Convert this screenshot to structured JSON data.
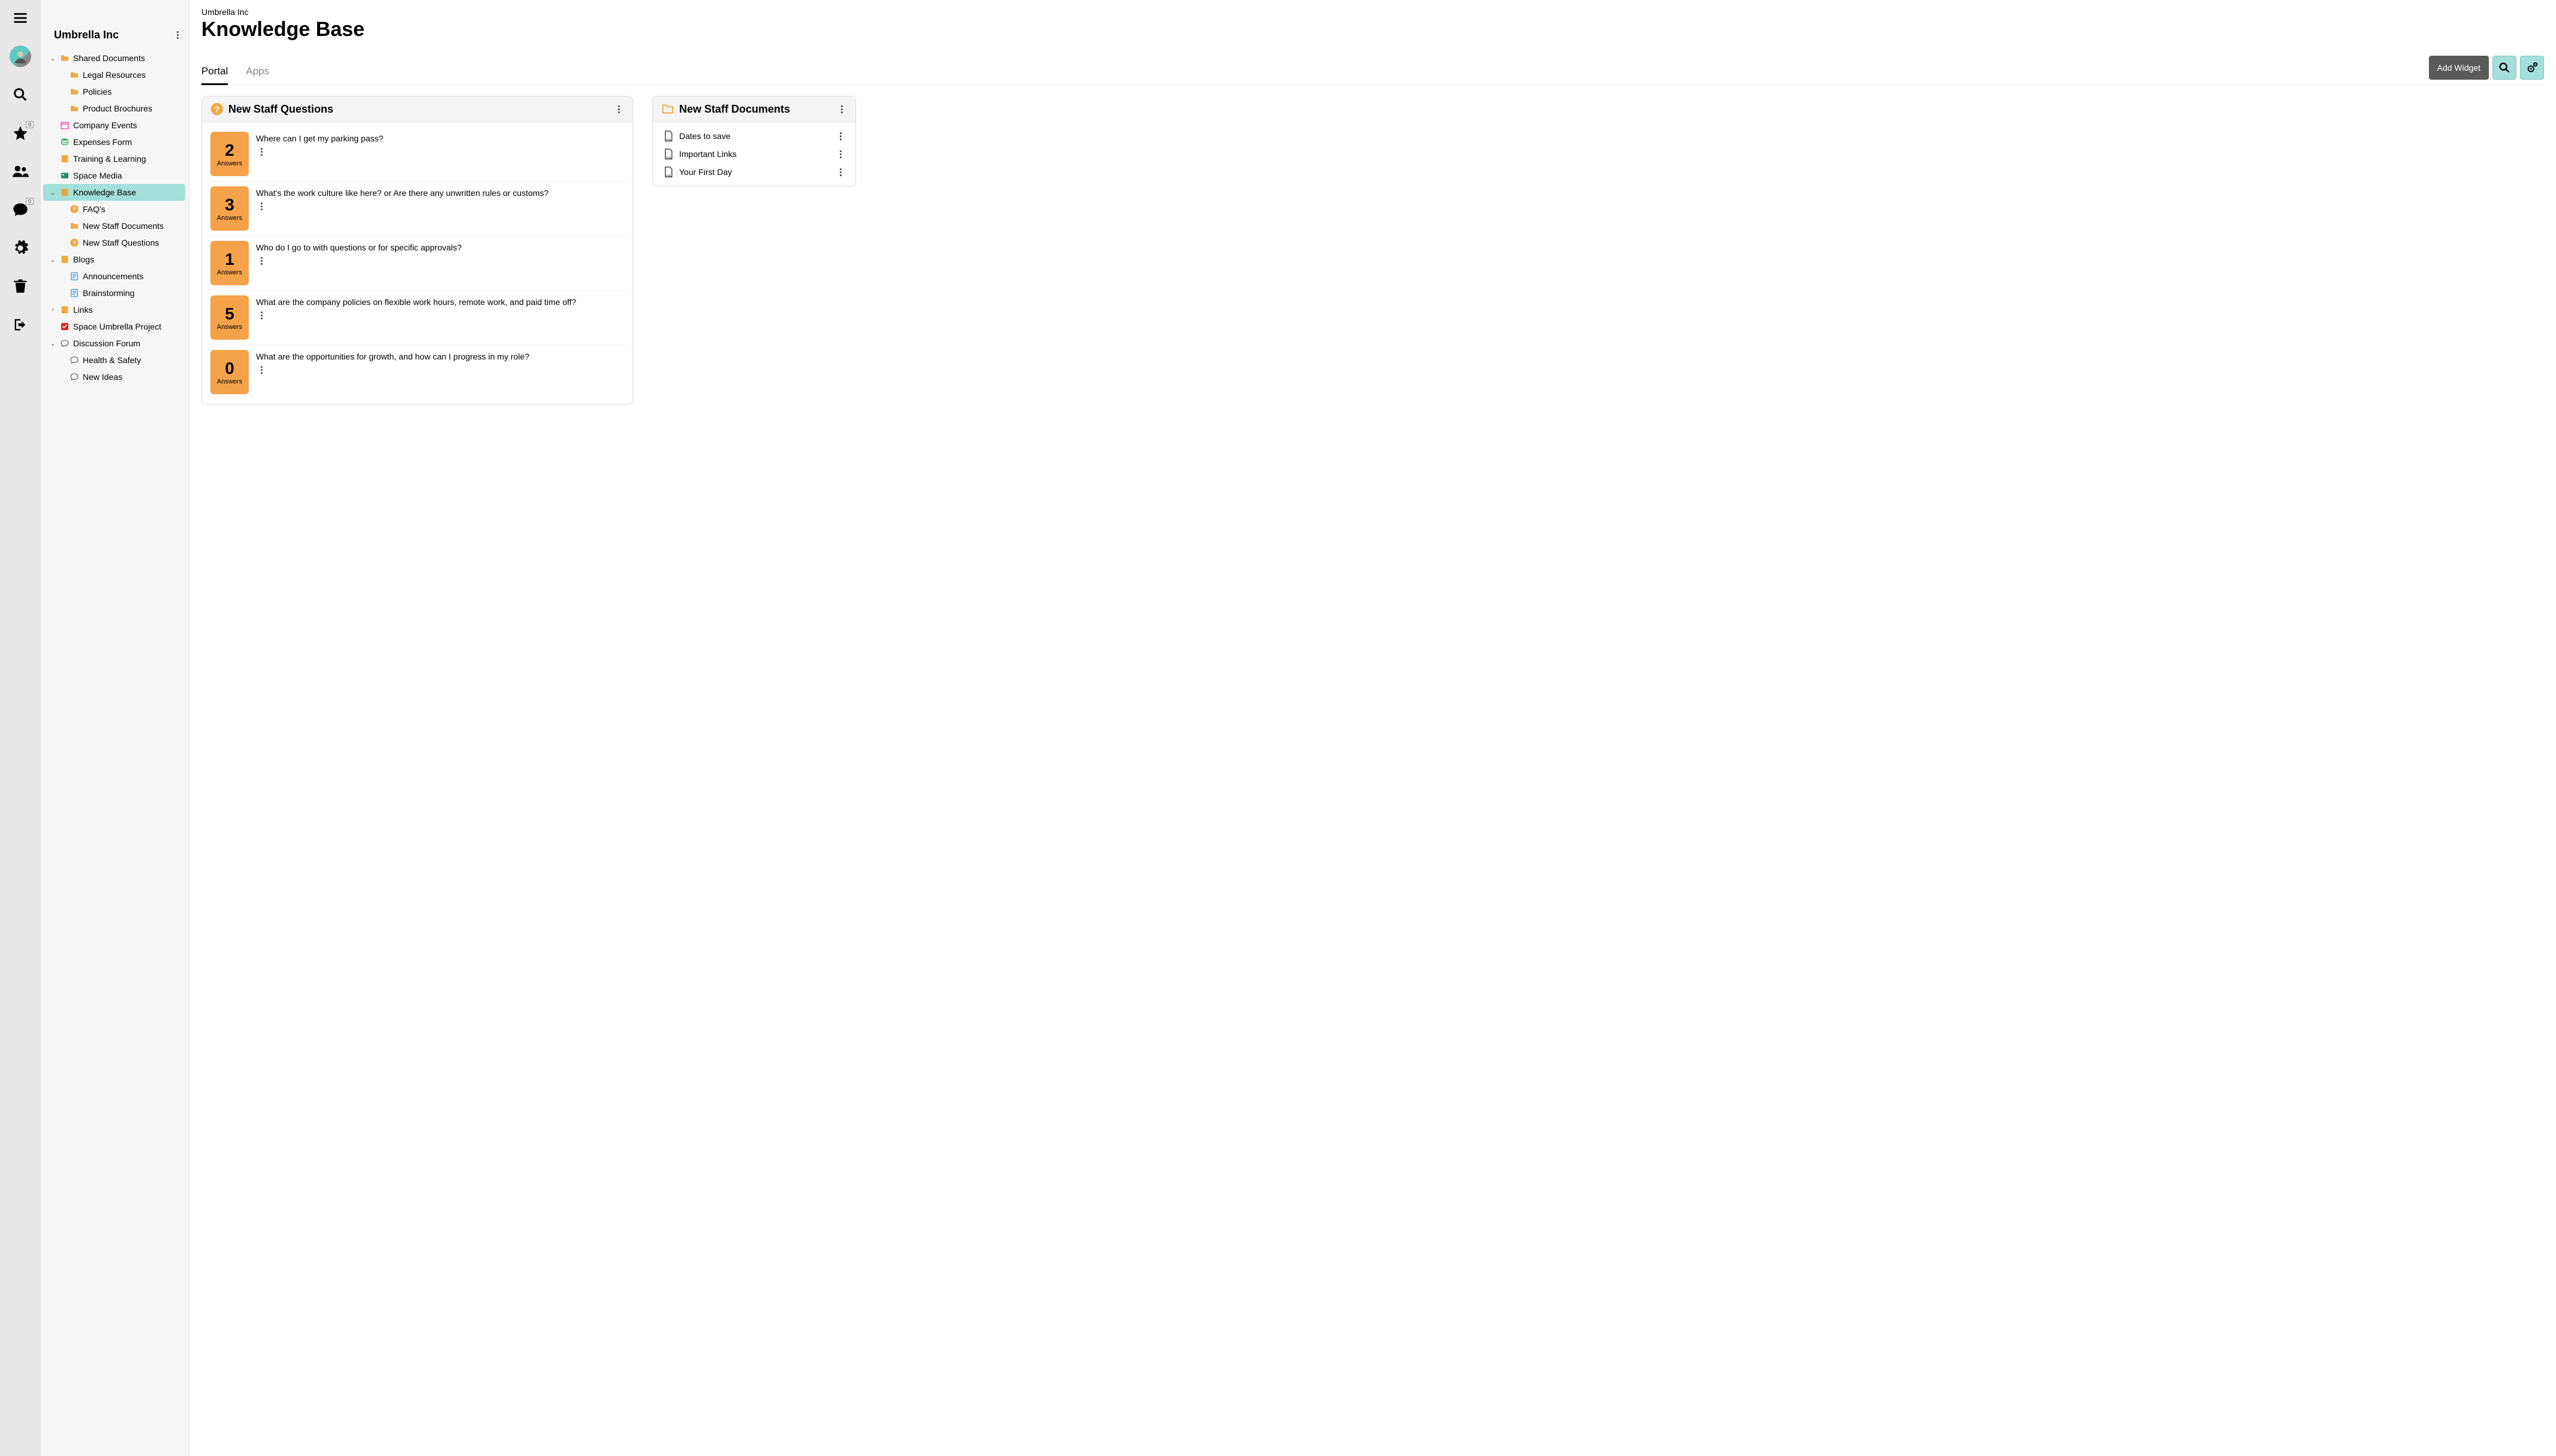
{
  "iconbar": {
    "star_badge": "0",
    "chat_badge": "0"
  },
  "sidebar": {
    "title": "Umbrella Inc",
    "tree": {
      "shared_docs": "Shared Documents",
      "legal": "Legal Resources",
      "policies": "Policies",
      "brochures": "Product Brochures",
      "events": "Company Events",
      "expenses": "Expenses Form",
      "training": "Training & Learning",
      "media": "Space Media",
      "kb": "Knowledge Base",
      "faqs": "FAQ's",
      "nsd": "New Staff Documents",
      "nsq": "New Staff Questions",
      "blogs": "Blogs",
      "announce": "Announcements",
      "brainstorm": "Brainstorming",
      "links": "Links",
      "umbrella_proj": "Space Umbrella Project",
      "forum": "Discussion Forum",
      "health": "Health & Safety",
      "ideas": "New Ideas"
    }
  },
  "main": {
    "crumb": "Umbrella Inc",
    "title": "Knowledge Base",
    "tabs": {
      "portal": "Portal",
      "apps": "Apps"
    },
    "add_widget": "Add Widget"
  },
  "questions_card": {
    "title": "New Staff Questions",
    "answers_label": "Answers",
    "items": [
      {
        "count": "2",
        "q": "Where can I get my parking pass?"
      },
      {
        "count": "3",
        "q": "What's the work culture like here? or Are there any unwritten rules or customs?"
      },
      {
        "count": "1",
        "q": "Who do I go to with questions or for specific approvals?"
      },
      {
        "count": "5",
        "q": "What are the company policies on flexible work hours, remote work, and paid time off?"
      },
      {
        "count": "0",
        "q": "What are the opportunities for growth, and how can I progress in my role?"
      }
    ]
  },
  "docs_card": {
    "title": "New Staff Documents",
    "items": [
      {
        "name": "Dates to save"
      },
      {
        "name": "Important Links"
      },
      {
        "name": "Your First Day"
      }
    ]
  }
}
